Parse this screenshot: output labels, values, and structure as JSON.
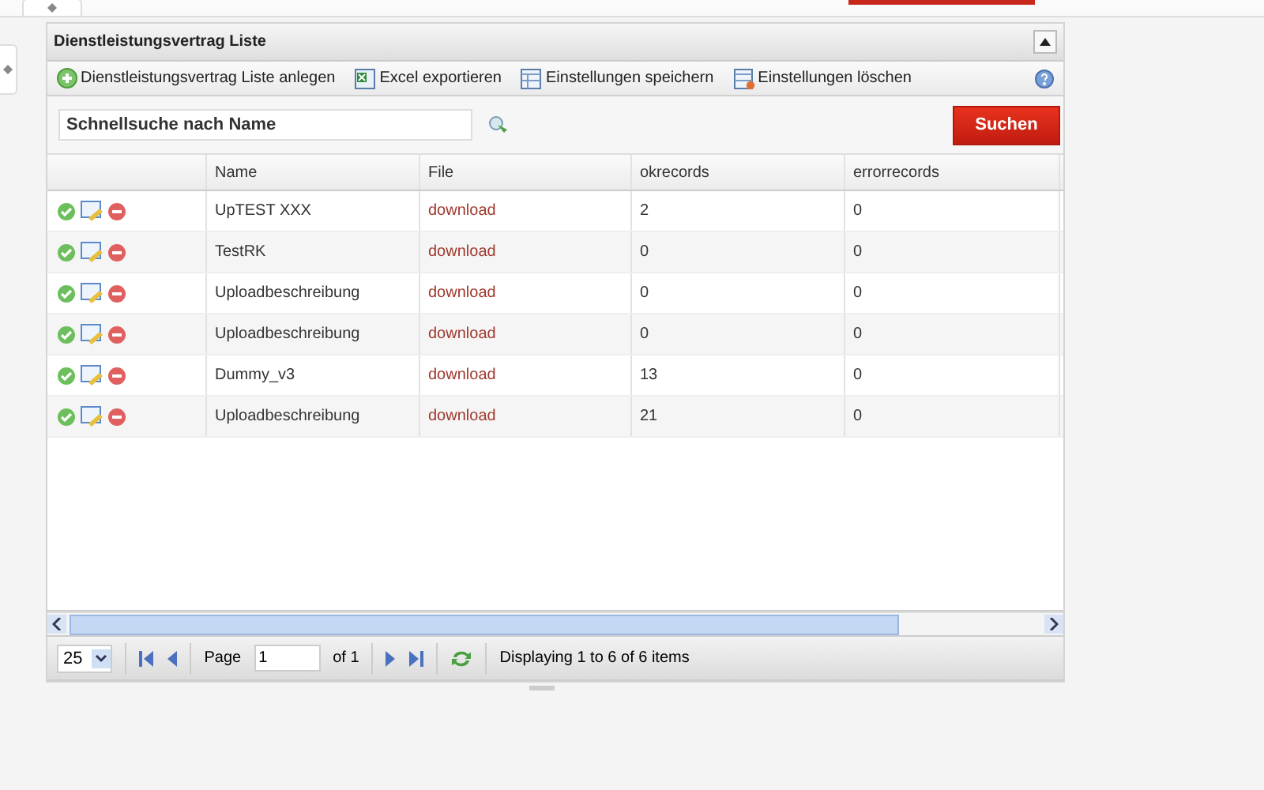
{
  "panel": {
    "title": "Dienstleistungsvertrag Liste"
  },
  "toolbar": [
    {
      "kind": "add",
      "label": "Dienstleistungsvertrag Liste anlegen"
    },
    {
      "kind": "excel",
      "label": "Excel exportieren"
    },
    {
      "kind": "save",
      "label": "Einstellungen speichern"
    },
    {
      "kind": "delete",
      "label": "Einstellungen löschen"
    }
  ],
  "search": {
    "placeholder": "Schnellsuche nach Name",
    "button": "Suchen"
  },
  "columns": [
    "Name",
    "File",
    "okrecords",
    "errorrecords"
  ],
  "rows": [
    {
      "name": "UpTEST XXX",
      "file": "download",
      "okrecords": "2",
      "errorrecords": "0"
    },
    {
      "name": "TestRK",
      "file": "download",
      "okrecords": "0",
      "errorrecords": "0"
    },
    {
      "name": "Uploadbeschreibung",
      "file": "download",
      "okrecords": "0",
      "errorrecords": "0"
    },
    {
      "name": "Uploadbeschreibung",
      "file": "download",
      "okrecords": "0",
      "errorrecords": "0"
    },
    {
      "name": "Dummy_v3",
      "file": "download",
      "okrecords": "13",
      "errorrecords": "0"
    },
    {
      "name": "Uploadbeschreibung",
      "file": "download",
      "okrecords": "21",
      "errorrecords": "0"
    }
  ],
  "paging": {
    "page_size": "25",
    "page_label": "Page",
    "page": "1",
    "page_count": "of 1",
    "status": "Displaying 1 to 6 of 6 items"
  }
}
